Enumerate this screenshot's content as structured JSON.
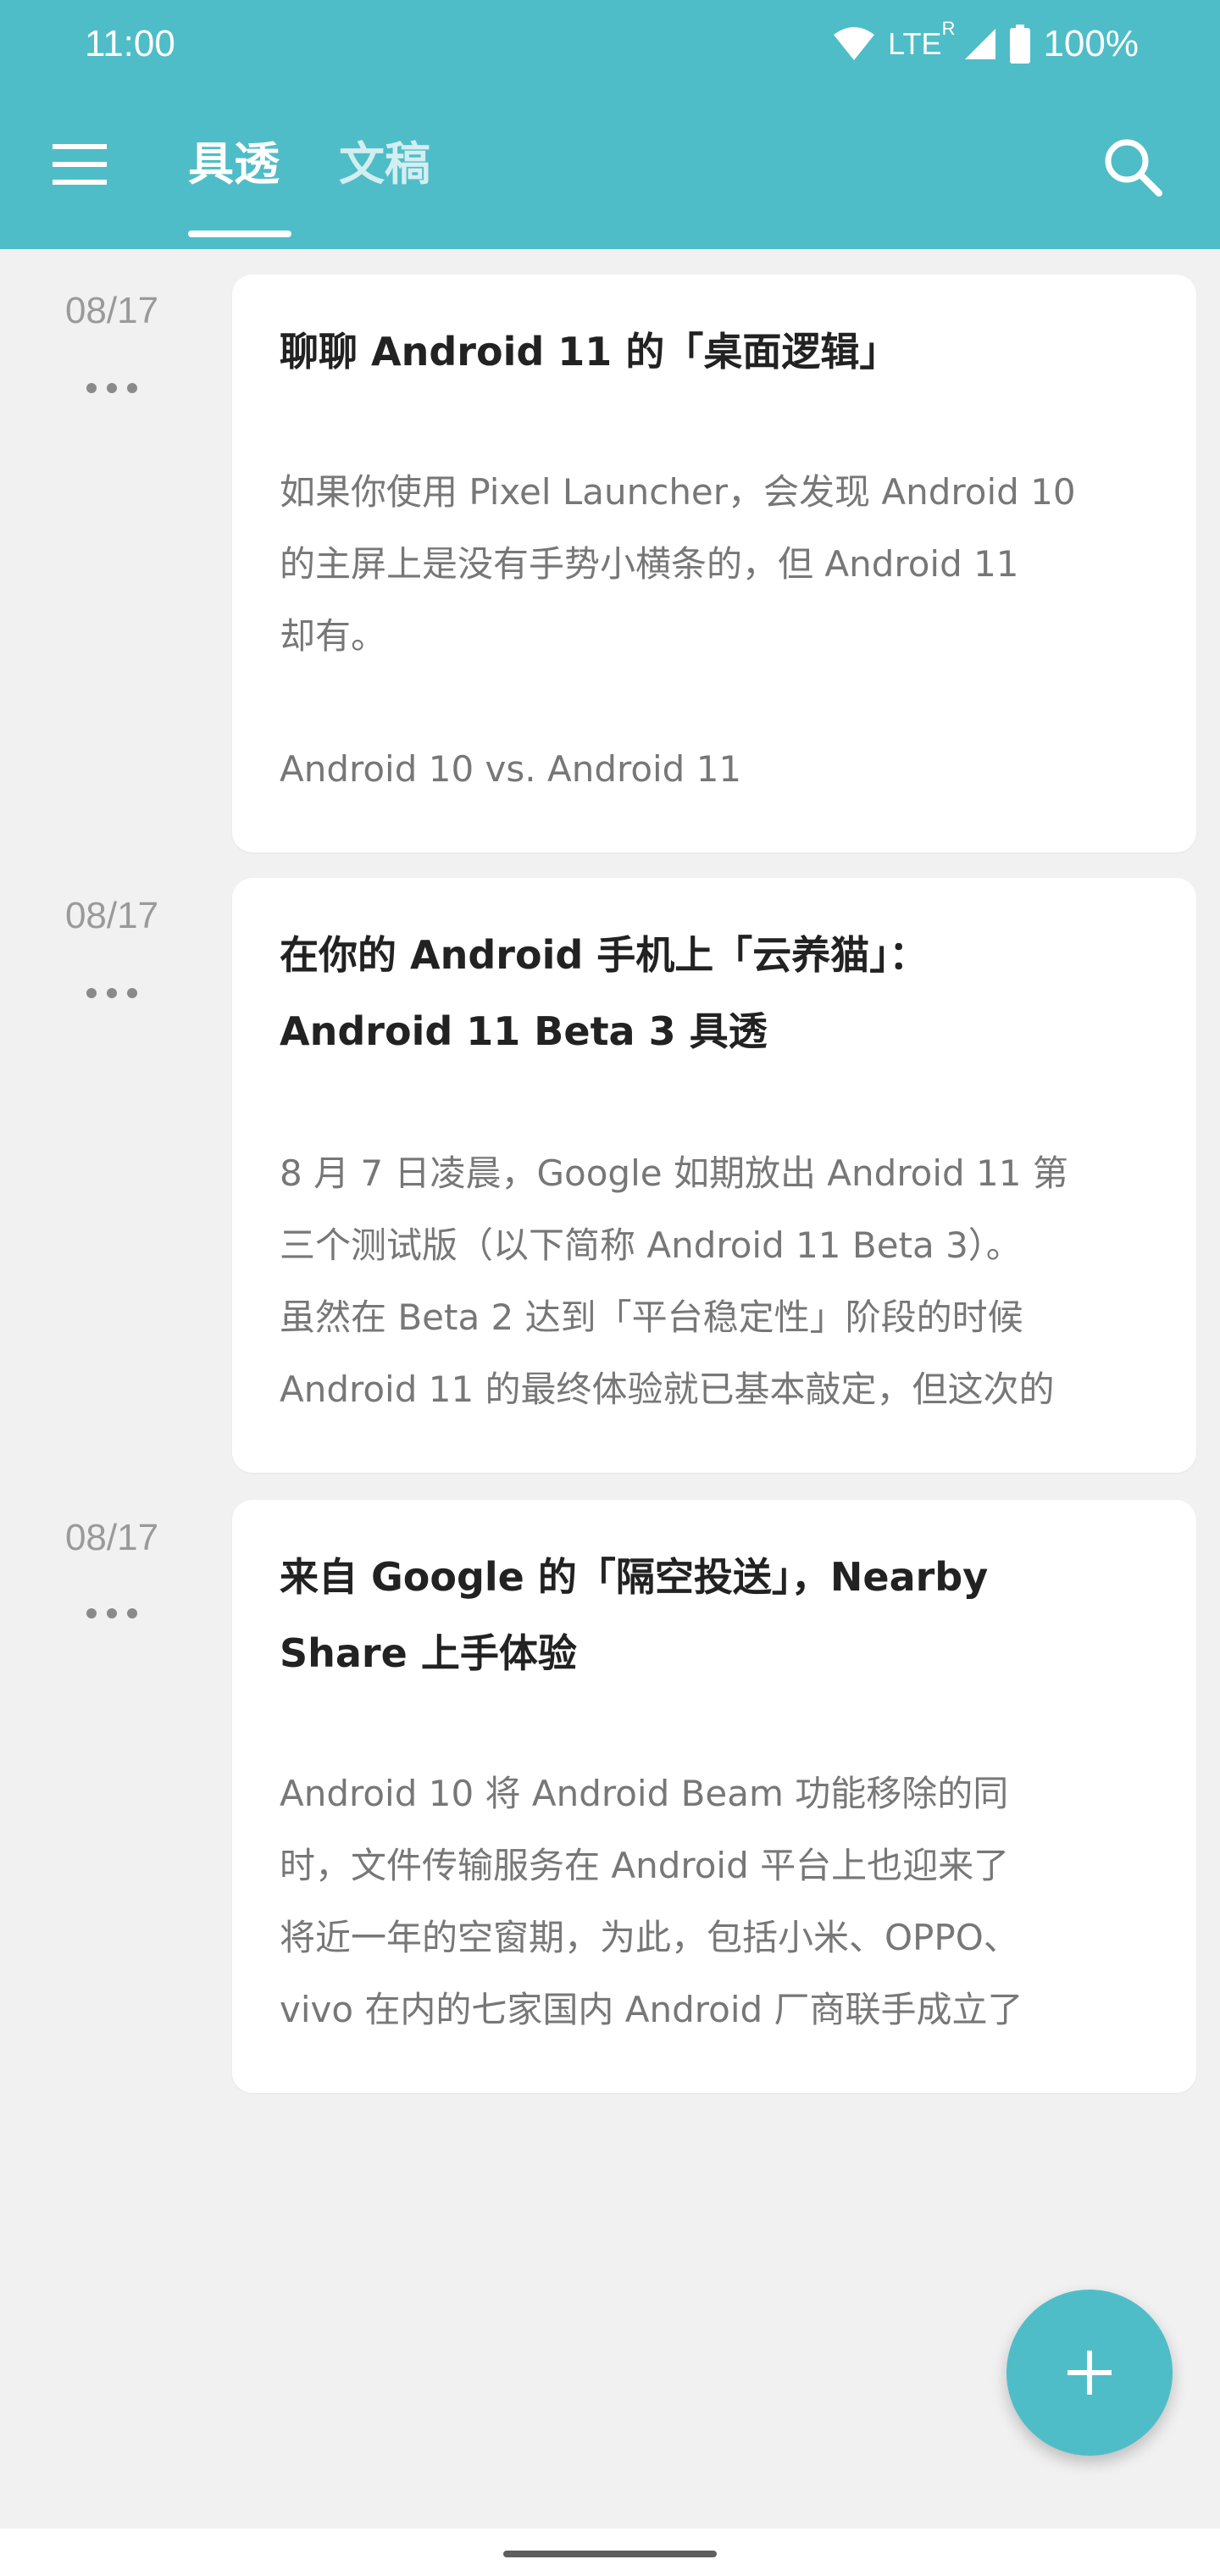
{
  "status_bar": {
    "time": "11:00",
    "network": "LTE",
    "roaming": "R",
    "battery": "100%"
  },
  "app_bar": {
    "tabs": [
      {
        "label": "具透",
        "active": true
      },
      {
        "label": "文稿",
        "active": false
      }
    ]
  },
  "entries": [
    {
      "date": "08/17",
      "title_lines": [
        "聊聊 Android 11 的「桌面逻辑」"
      ],
      "body_lines": [
        "如果你使用 Pixel Launcher，会发现 Android 10",
        "的主屏上是没有手势小横条的，但 Android 11",
        "却有。",
        "",
        "Android 10 vs. Android 11"
      ]
    },
    {
      "date": "08/17",
      "title_lines": [
        "在你的 Android 手机上「云养猫」：",
        "Android 11 Beta 3 具透"
      ],
      "body_lines": [
        "8 月 7 日凌晨，Google 如期放出 Android 11 第",
        "三个测试版（以下简称 Android 11 Beta 3）。",
        "虽然在 Beta 2 达到「平台稳定性」阶段的时候",
        "Android 11 的最终体验就已基本敲定，但这次的"
      ]
    },
    {
      "date": "08/17",
      "title_lines": [
        "来自 Google 的「隔空投送」，Nearby",
        "Share 上手体验"
      ],
      "body_lines": [
        "Android 10 将 Android Beam 功能移除的同",
        "时，文件传输服务在 Android 平台上也迎来了",
        "将近一年的空窗期，为此，包括小米、OPPO、",
        "vivo 在内的七家国内 Android 厂商联手成立了"
      ]
    }
  ],
  "fab": {
    "icon": "plus-icon"
  },
  "colors": {
    "accent": "#4fbdc7",
    "background": "#f1f1f2",
    "card": "#ffffff",
    "title_text": "#222222",
    "body_text": "#777777",
    "date_text": "#9a9a9a"
  }
}
